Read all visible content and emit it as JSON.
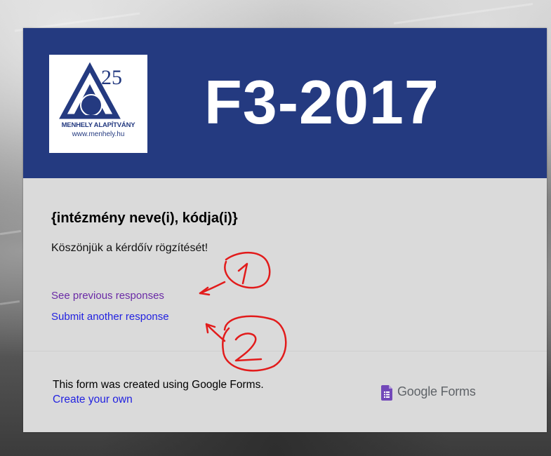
{
  "header": {
    "logo_name": "MENHELY ALAPÍTVÁNY",
    "logo_url": "www.menhely.hu",
    "logo_number": "25",
    "title": "F3-2017"
  },
  "body": {
    "title": "{intézmény neve(i), kódja(i)}",
    "confirmation": "Köszönjük a kérdőív rögzítését!",
    "see_previous_label": "See previous responses",
    "submit_another_label": "Submit another response"
  },
  "footer": {
    "created_text": "This form was created using Google Forms.",
    "create_link": "Create your own",
    "brand": "Google Forms"
  },
  "annotations": {
    "marker_1": "1",
    "marker_2": "2",
    "color": "#e21b1b"
  },
  "colors": {
    "header_bg": "#243a80",
    "card_bg": "#dadada",
    "visited_link": "#6a2aa6",
    "link": "#2222e0",
    "forms_purple": "#7248b9"
  }
}
